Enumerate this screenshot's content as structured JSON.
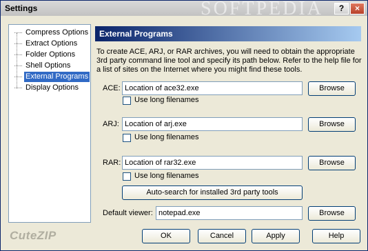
{
  "window": {
    "title": "Settings",
    "watermark": "SOFTPEDIA"
  },
  "titlebar_buttons": {
    "help": "?",
    "close": "×"
  },
  "tree": {
    "items": [
      {
        "label": "Compress Options",
        "selected": false
      },
      {
        "label": "Extract Options",
        "selected": false
      },
      {
        "label": "Folder Options",
        "selected": false
      },
      {
        "label": "Shell Options",
        "selected": false
      },
      {
        "label": "External Programs",
        "selected": true
      },
      {
        "label": "Display Options",
        "selected": false
      }
    ]
  },
  "panel": {
    "header": "External Programs",
    "description": "To create ACE, ARJ, or RAR archives, you will need to obtain the appropriate 3rd party command line tool and specify its path below. Refer to the help file for a list of sites on the Internet where you might find these tools."
  },
  "programs": {
    "ace": {
      "label": "ACE:",
      "value": "Location of ace32.exe",
      "browse": "Browse",
      "long_names": "Use long filenames"
    },
    "arj": {
      "label": "ARJ:",
      "value": "Location of arj.exe",
      "browse": "Browse",
      "long_names": "Use long filenames"
    },
    "rar": {
      "label": "RAR:",
      "value": "Location of rar32.exe",
      "browse": "Browse",
      "long_names": "Use long filenames"
    }
  },
  "autosearch": {
    "label": "Auto-search for installed 3rd party tools"
  },
  "viewer": {
    "label": "Default viewer:",
    "value": "notepad.exe",
    "browse": "Browse"
  },
  "footer": {
    "brand": "CuteZIP",
    "ok": "OK",
    "cancel": "Cancel",
    "apply": "Apply",
    "help": "Help"
  },
  "colors": {
    "header_start": "#0a246a",
    "header_end": "#a6caf0",
    "selection": "#316ac5"
  }
}
